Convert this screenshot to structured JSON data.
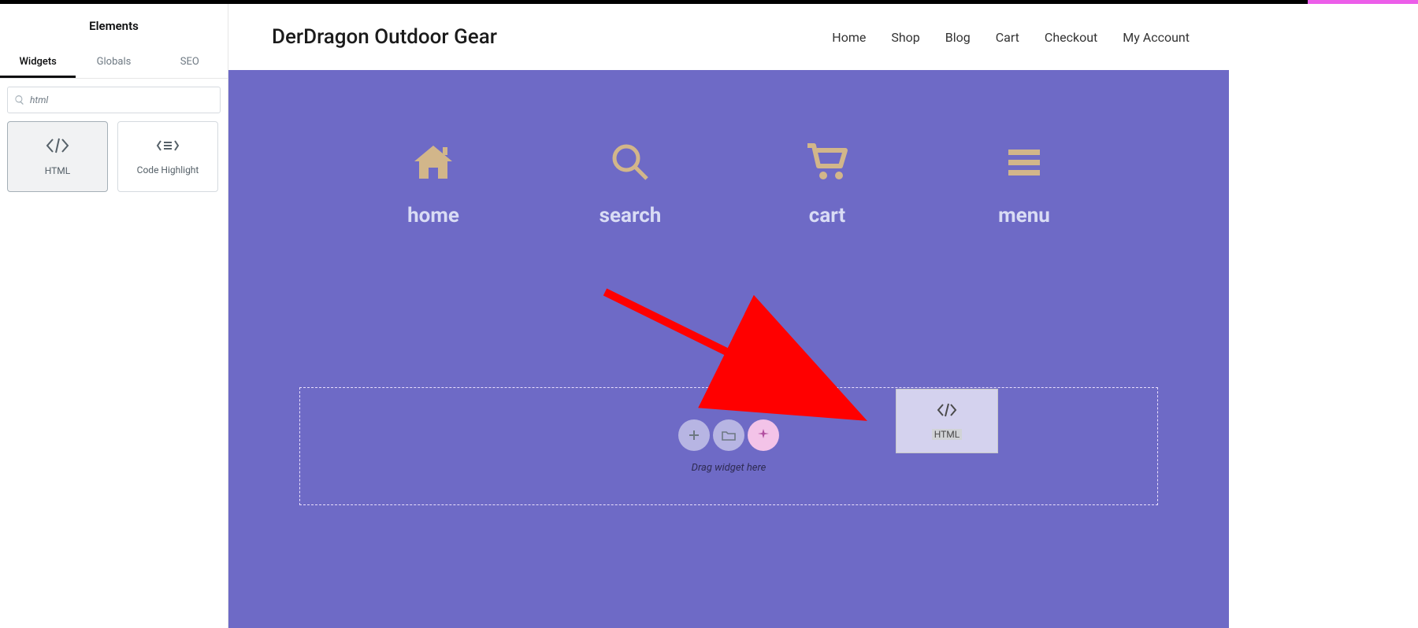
{
  "sidebar": {
    "title": "Elements",
    "tabs": [
      "Widgets",
      "Globals",
      "SEO"
    ],
    "active_tab": 0,
    "search_value": "html",
    "widgets": [
      {
        "label": "HTML",
        "icon": "code",
        "selected": true
      },
      {
        "label": "Code Highlight",
        "icon": "code-highlight",
        "selected": false
      }
    ]
  },
  "site": {
    "title": "DerDragon Outdoor Gear",
    "nav": [
      "Home",
      "Shop",
      "Blog",
      "Cart",
      "Checkout",
      "My Account"
    ]
  },
  "canvas": {
    "nav_icons": [
      {
        "icon": "home",
        "label": "home"
      },
      {
        "icon": "search",
        "label": "search"
      },
      {
        "icon": "cart",
        "label": "cart"
      },
      {
        "icon": "menu",
        "label": "menu"
      }
    ],
    "drop_hint": "Drag widget here",
    "drag_ghost_label": "HTML"
  },
  "collapse_glyph": "‹"
}
